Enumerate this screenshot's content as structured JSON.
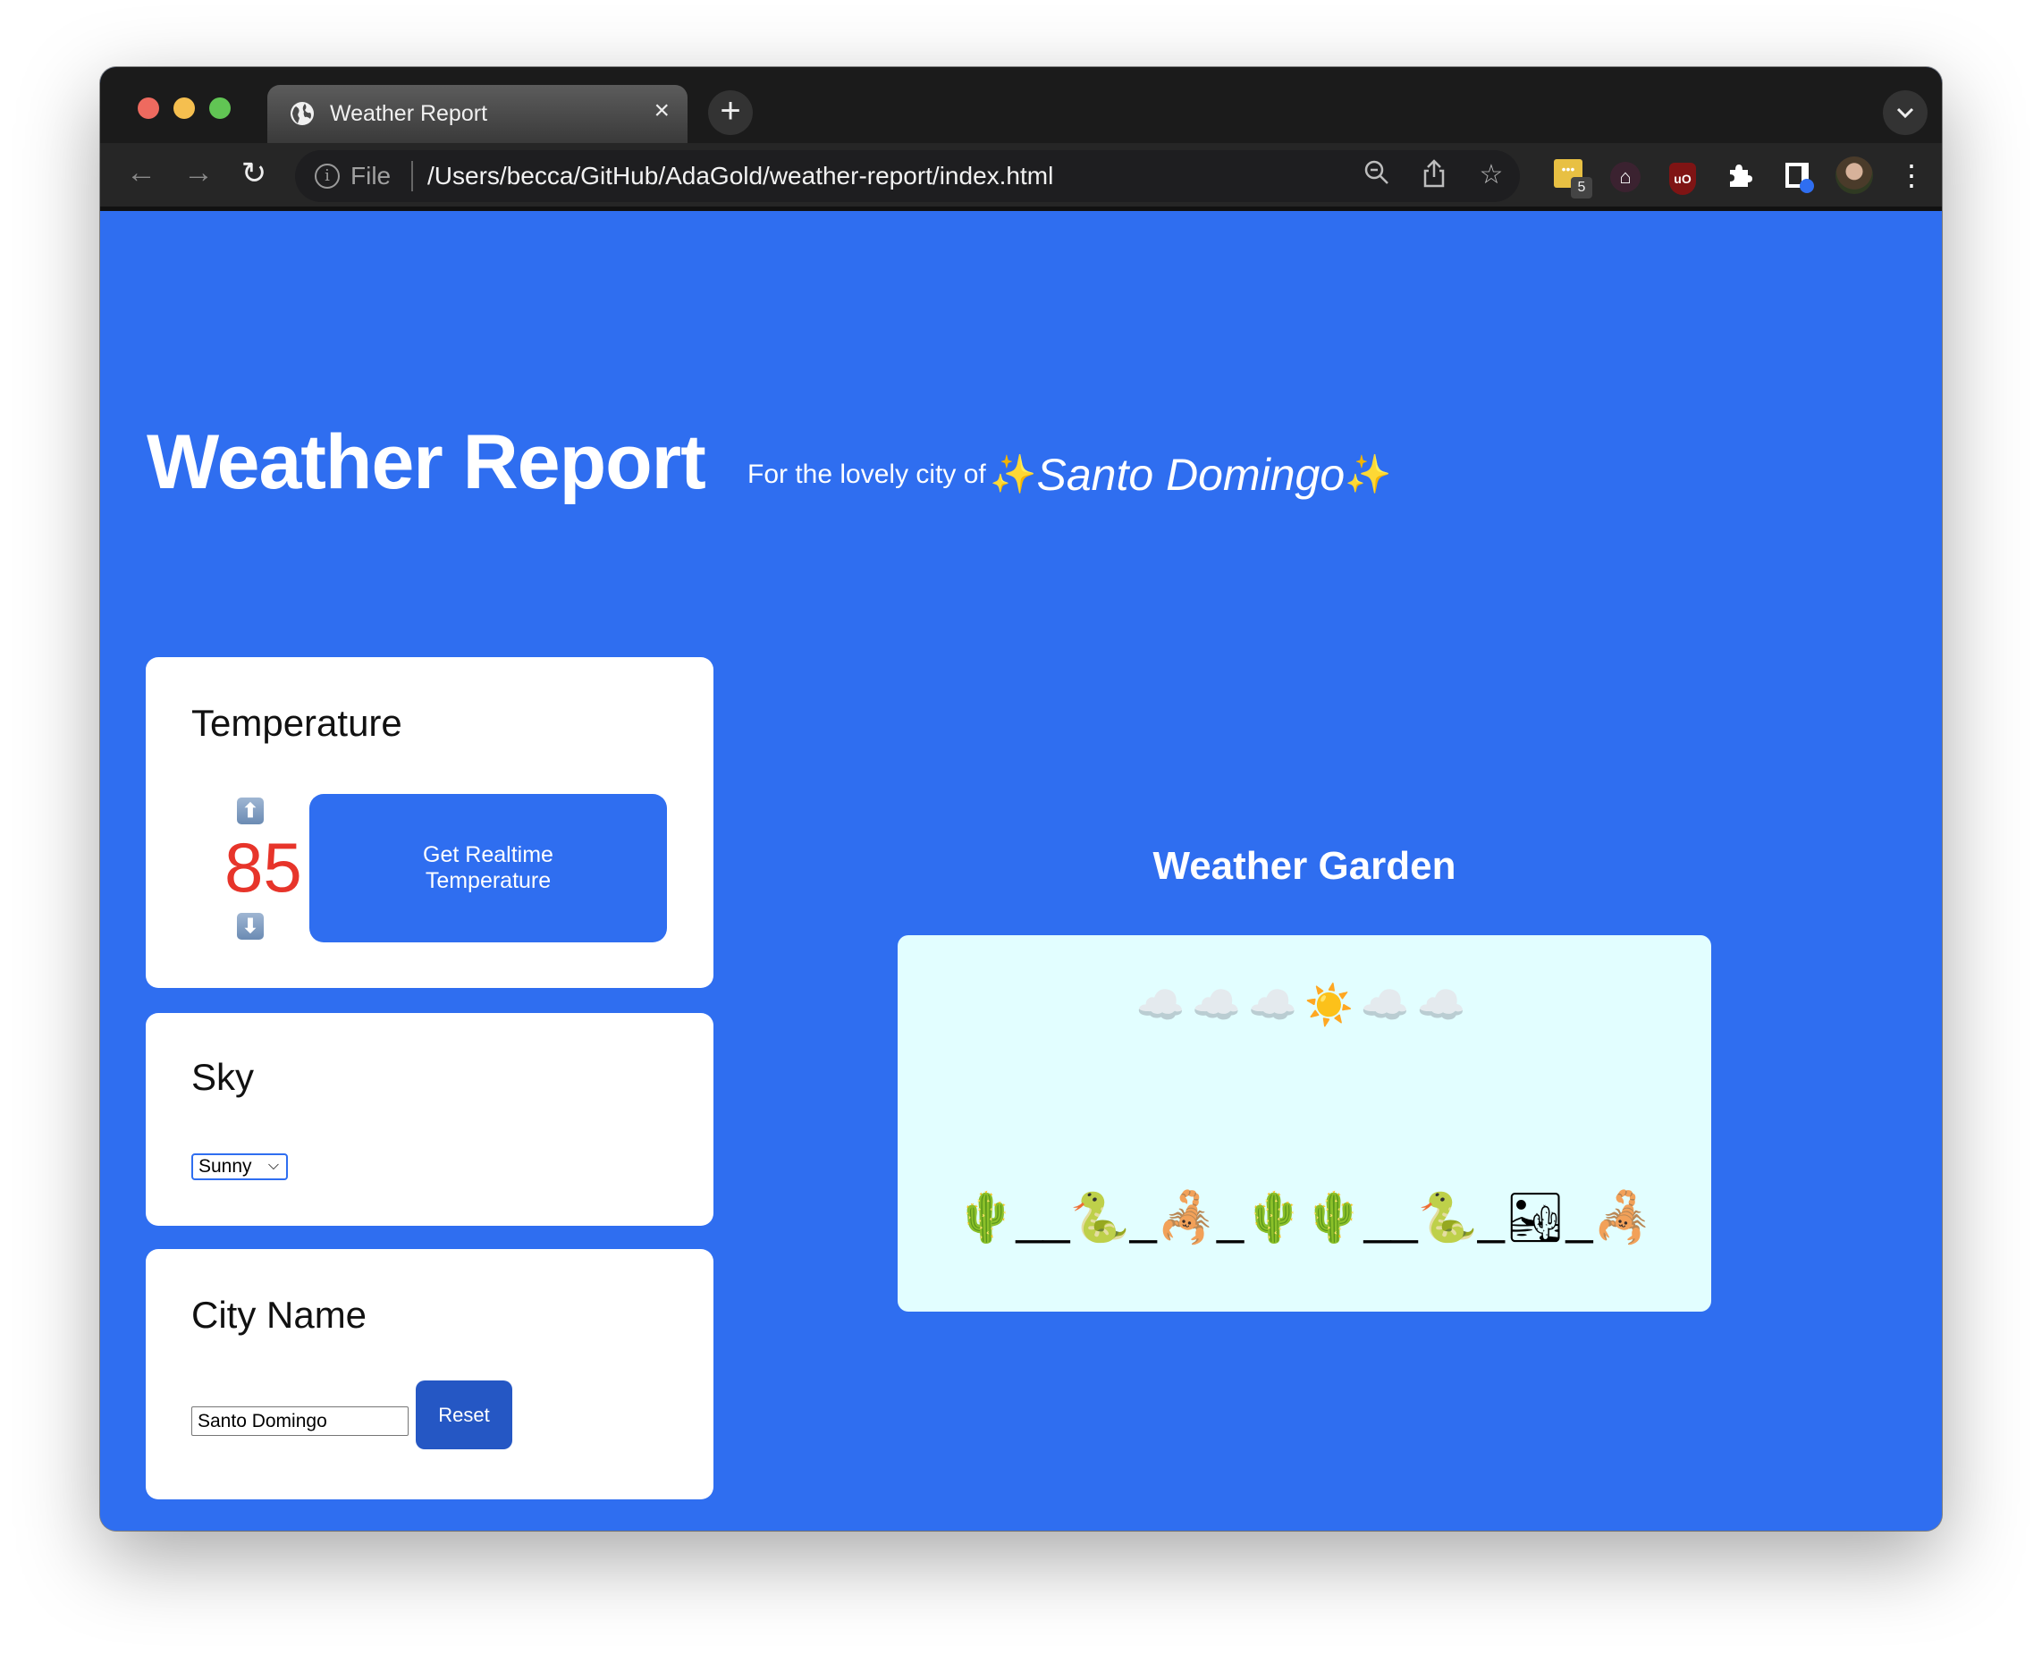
{
  "browser": {
    "tab_title": "Weather Report",
    "tab_close": "×",
    "new_tab": "+",
    "tab_menu": "⌄",
    "scheme_label": "File",
    "url": "/Users/becca/GitHub/AdaGold/weather-report/index.html",
    "nav": {
      "back": "←",
      "forward": "→",
      "reload": "↻"
    },
    "omnibox_icons": {
      "zoom": "🔍︎",
      "share": "⇪",
      "bookmark": "☆"
    },
    "extensions": {
      "password_manager_badge": "5",
      "password_manager_glyph": "•••",
      "home_glyph": "⌂",
      "ublock_glyph": "uO",
      "puzzle_glyph": "✚",
      "menu_glyph": "⋮"
    }
  },
  "header": {
    "title": "Weather Report",
    "subtitle_lead": "For the lovely city of",
    "sparkle": "✨",
    "city": "Santo Domingo"
  },
  "temperature": {
    "heading": "Temperature",
    "value": "85",
    "value_color": "#e7342a",
    "up_glyph": "⬆",
    "down_glyph": "⬇",
    "realtime_button": "Get Realtime Temperature"
  },
  "sky": {
    "heading": "Sky",
    "selected": "Sunny",
    "chevron": "⌵"
  },
  "city": {
    "heading": "City Name",
    "input_value": "Santo Domingo",
    "reset_button": "Reset"
  },
  "garden": {
    "title": "Weather Garden",
    "sky": "☁️☁️☁️☀️☁️☁️",
    "landscape": "🌵__🐍_🦂_🌵🌵__🐍_🏜_🦂"
  },
  "colors": {
    "page_bg": "#2f6ef0",
    "garden_bg": "#e2feff",
    "reset_bg": "#2557c4"
  }
}
